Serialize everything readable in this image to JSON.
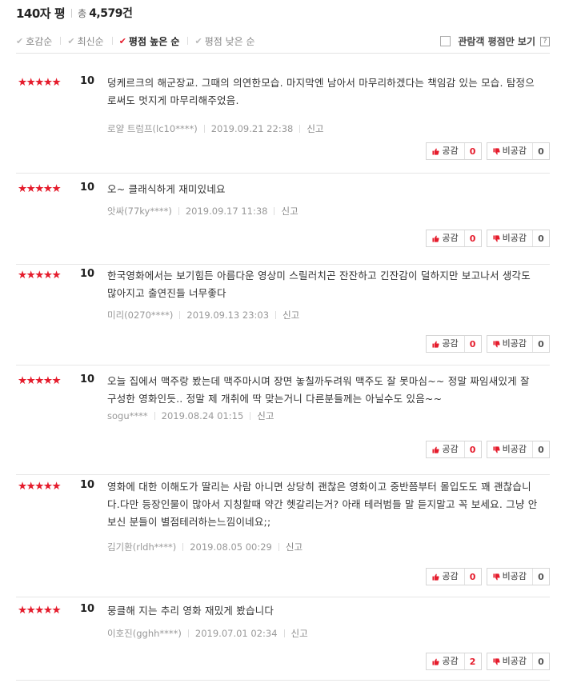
{
  "header": {
    "title": "140자 평",
    "total_label": "총",
    "total_count": "4,579건"
  },
  "sort": [
    {
      "label": "호감순",
      "active": false
    },
    {
      "label": "최신순",
      "active": false
    },
    {
      "label": "평점 높은 순",
      "active": true
    },
    {
      "label": "평점 낮은 순",
      "active": false
    }
  ],
  "filter": {
    "label": "관람객 평점만 보기",
    "help": "?",
    "checked": false
  },
  "buttons": {
    "like_label": "공감",
    "dislike_label": "비공감"
  },
  "colors": {
    "accent": "#e51c2c"
  },
  "reviews": [
    {
      "rating": 5,
      "score": "10",
      "text": "덩케르크의 해군장교. 그때의 의연한모습. 마지막엔 남아서 마무리하겠다는 책임감 있는 모습. 탐정으로써도 멋지게 마무리해주었음.",
      "author": "로얄 트럼프(lc10****)",
      "date": "2019.09.21 22:38",
      "report": "신고",
      "likes": "0",
      "dislikes": "0"
    },
    {
      "rating": 5,
      "score": "10",
      "text": "오~ 클래식하게 재미있네요",
      "author": "앗싸(77ky****)",
      "date": "2019.09.17 11:38",
      "report": "신고",
      "likes": "0",
      "dislikes": "0"
    },
    {
      "rating": 5,
      "score": "10",
      "text": "한국영화에서는 보기힘든 아름다운 영상미 스릴러치곤 잔잔하고 긴잔감이 덜하지만 보고나서 생각도 많아지고 출연진들 너무좋다",
      "author": "미리(0270****)",
      "date": "2019.09.13 23:03",
      "report": "신고",
      "likes": "0",
      "dislikes": "0"
    },
    {
      "rating": 5,
      "score": "10",
      "text": "오늘 집에서 맥주랑 봤는데 맥주마시며 장면 놓칠까두려워 맥주도 잘 못마심~~ 정말 짜임새있게 잘 구성한 영화인듯.. 정말 제 개취에 딱 맞는거니 다른분들께는 아닐수도 있음~~",
      "author": "sogu****",
      "date": "2019.08.24 01:15",
      "report": "신고",
      "likes": "0",
      "dislikes": "0"
    },
    {
      "rating": 5,
      "score": "10",
      "text": "영화에 대한 이해도가 딸리는 사람 아니면 상당히 괜찮은 영화이고 중반쯤부터 몰입도도 꽤 괜찮습니다.다만 등장인물이 많아서 지칭할때 약간 헷갈리는거? 아래 테러범들 말 듣지말고 꼭 보세요. 그냥 안보신 분들이 별점테러하는느낌이네요;;",
      "author": "김기환(rldh****)",
      "date": "2019.08.05 00:29",
      "report": "신고",
      "likes": "0",
      "dislikes": "0"
    },
    {
      "rating": 5,
      "score": "10",
      "text": "뭉클해 지는 추리 영화 재밌게 봤습니다",
      "author": "이호진(gghh****)",
      "date": "2019.07.01 02:34",
      "report": "신고",
      "likes": "2",
      "dislikes": "0"
    }
  ]
}
